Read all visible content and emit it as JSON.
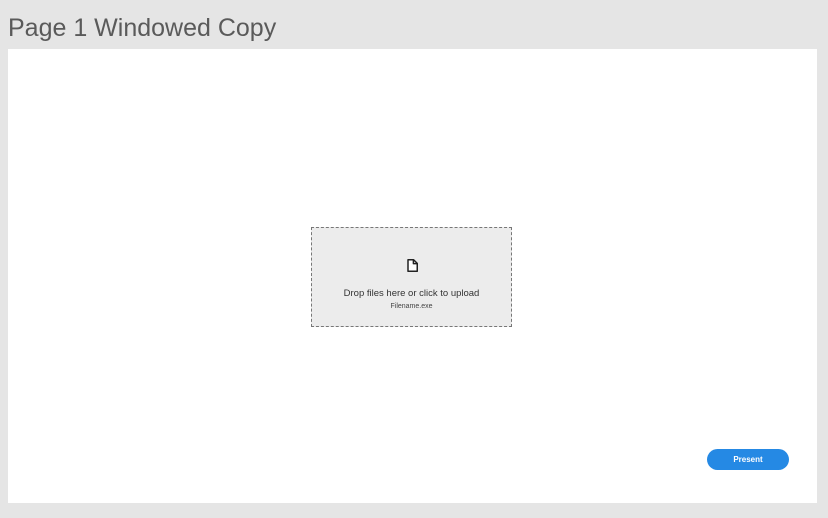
{
  "page": {
    "title": "Page 1 Windowed Copy"
  },
  "upload": {
    "prompt": "Drop files here or click to upload",
    "filename": "Filename.exe",
    "icon": "file-icon"
  },
  "actions": {
    "present_label": "Present"
  },
  "colors": {
    "accent": "#2589e4",
    "background": "#e5e5e5",
    "canvas": "#ffffff",
    "dropzone": "#ececec"
  }
}
